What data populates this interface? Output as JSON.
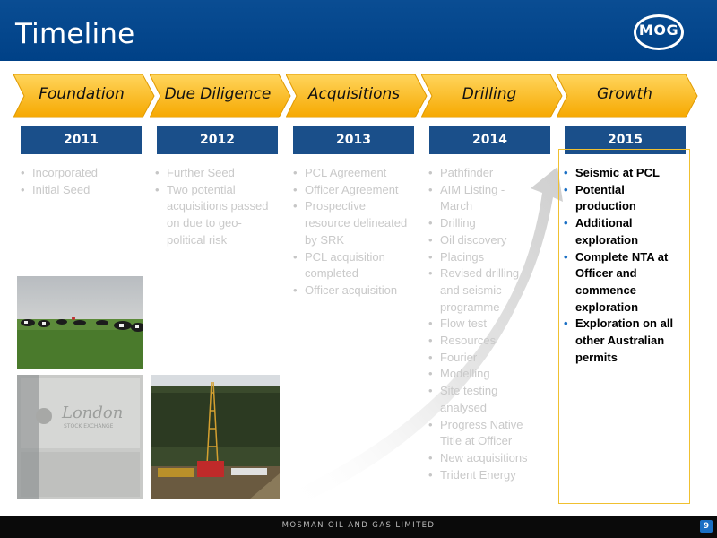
{
  "slide": {
    "title": "Timeline",
    "logo_text": "MOG",
    "footer_text": "MOSMAN OIL AND GAS LIMITED",
    "page_number": "9"
  },
  "phases": [
    {
      "label": "Foundation",
      "year": "2011",
      "items": [
        "Incorporated",
        "Initial Seed"
      ]
    },
    {
      "label": "Due Diligence",
      "year": "2012",
      "items": [
        "Further Seed",
        "Two potential acquisitions passed on due to geo-political risk"
      ]
    },
    {
      "label": "Acquisitions",
      "year": "2013",
      "items": [
        "PCL Agreement",
        "Officer Agreement",
        "Prospective resource delineated by SRK",
        "PCL acquisition completed",
        "Officer acquisition"
      ]
    },
    {
      "label": "Drilling",
      "year": "2014",
      "items": [
        "Pathfinder",
        "AIM Listing - March",
        "Drilling",
        "Oil discovery",
        "Placings",
        "Revised drilling and seismic programme",
        "Flow test",
        "Resources",
        "Fourier",
        "Modelling",
        "Site testing analysed",
        "Progress Native Title at Officer",
        "New acquisitions",
        "Trident Energy"
      ]
    },
    {
      "label": "Growth",
      "year": "2015",
      "items": [
        "Seismic at PCL",
        "Potential production",
        "Additional exploration",
        "Complete NTA at Officer and commence exploration",
        "Exploration on all other Australian permits"
      ]
    }
  ],
  "photos": {
    "stock_exchange_sign_line1": "London",
    "stock_exchange_sign_line2": "STOCK EXCHANGE"
  },
  "colors": {
    "header_blue": "#004187",
    "year_blue": "#1a4f8a",
    "arrow_gold": "#f8b820",
    "highlight_border": "#f0c030"
  }
}
